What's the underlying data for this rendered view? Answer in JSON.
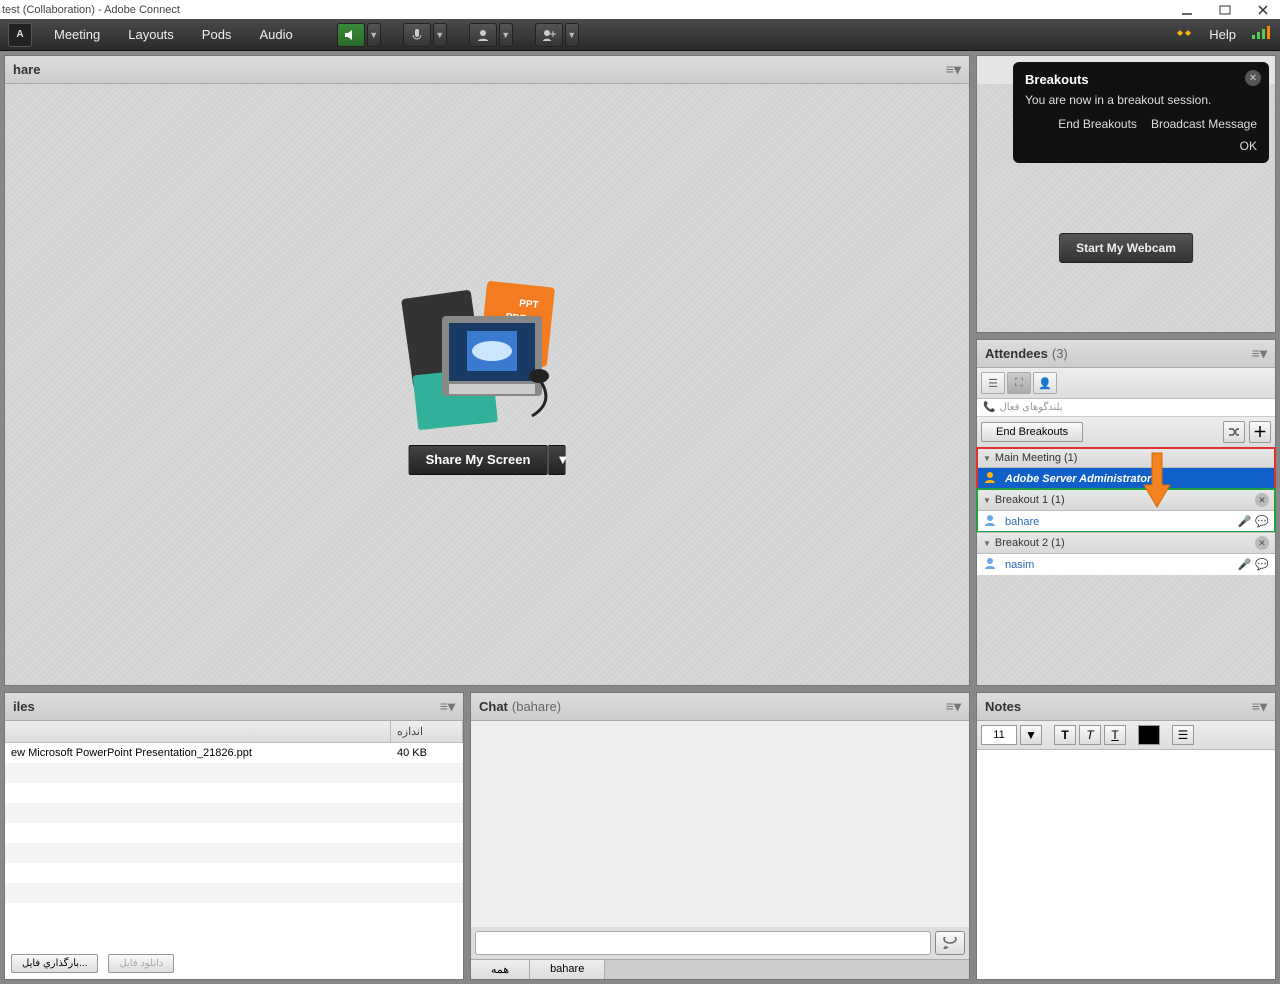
{
  "window": {
    "title": "test (Collaboration) - Adobe Connect"
  },
  "menubar": {
    "meeting": "Meeting",
    "layouts": "Layouts",
    "pods": "Pods",
    "audio": "Audio",
    "help": "Help"
  },
  "share": {
    "title": "hare",
    "button": "Share My Screen"
  },
  "popup": {
    "title": "Breakouts",
    "msg": "You are now in a breakout session.",
    "end": "End Breakouts",
    "broadcast": "Broadcast Message",
    "ok": "OK"
  },
  "webcam": {
    "start": "Start My Webcam"
  },
  "attendees": {
    "title": "Attendees",
    "count": "(3)",
    "active_speakers": "بلندگوهای فعال",
    "end_breakouts": "End Breakouts",
    "groups": [
      {
        "label": "Main Meeting (1)",
        "items": [
          {
            "name": "Adobe Server Administrator"
          }
        ],
        "highlight": "red",
        "selected": true
      },
      {
        "label": "Breakout 1 (1)",
        "items": [
          {
            "name": "bahare"
          }
        ],
        "highlight": "green",
        "closable": true,
        "status": true
      },
      {
        "label": "Breakout 2 (1)",
        "items": [
          {
            "name": "nasim"
          }
        ],
        "closable": true,
        "status": true
      }
    ]
  },
  "files": {
    "title": "iles",
    "col_name": "",
    "col_size": "اندازه",
    "rows": [
      {
        "name": "ew Microsoft PowerPoint Presentation_21826.ppt",
        "size": "40 KB"
      }
    ],
    "upload": "بارگذاري فايل...",
    "download": "دانلود فایل"
  },
  "chat": {
    "title": "Chat",
    "sub": "(bahare)",
    "tab_all": "همه",
    "tab_user": "bahare"
  },
  "notes": {
    "title": "Notes",
    "fontsize": "11"
  }
}
